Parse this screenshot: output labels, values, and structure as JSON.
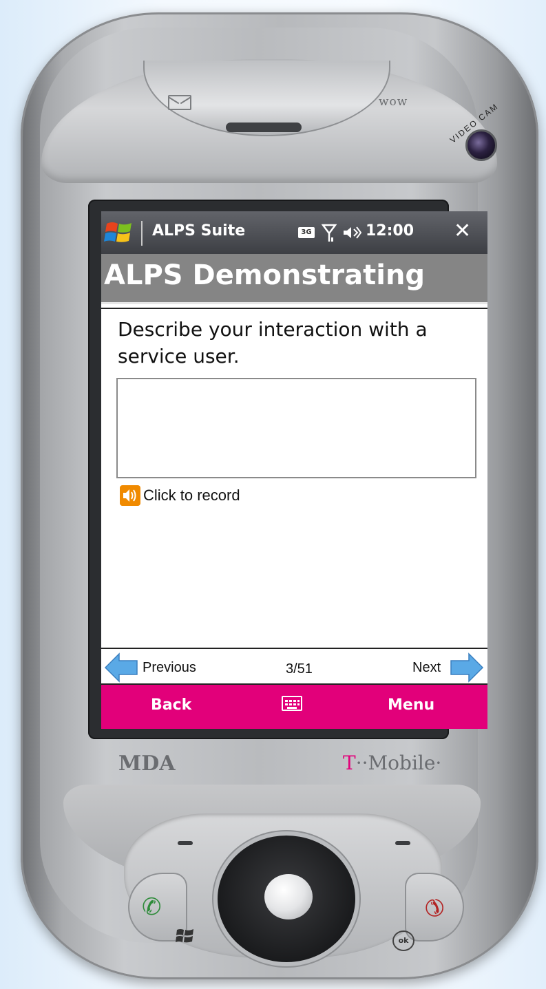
{
  "device": {
    "brand_left": "MDA",
    "brand_right_t": "T",
    "brand_right_rest": "··Mobile·",
    "camera_label": "VIDEO CAM",
    "top_logo": "wow",
    "ok_key_label": "ok"
  },
  "statusbar": {
    "app_title": "ALPS Suite",
    "network_badge": "3G",
    "time": "12:00",
    "close_glyph": "✕"
  },
  "page": {
    "header": "ALPS Demonstrating",
    "question": "Describe your interaction with a service user.",
    "answer_value": "",
    "record_label": "Click to record"
  },
  "pager": {
    "previous_label": "Previous",
    "page_indicator": "3/51",
    "next_label": "Next"
  },
  "softkeys": {
    "left_label": "Back",
    "right_label": "Menu"
  },
  "colors": {
    "softkey_bar": "#e2007a",
    "header_bg": "#858585",
    "titlebar_bg": "#3d3f44",
    "arrow_blue": "#5aa9e6",
    "record_orange": "#f08a00"
  },
  "icons": {
    "start": "windows-flag-icon",
    "signal": "antenna-signal-icon",
    "volume": "speaker-volume-icon",
    "record": "speaker-record-icon",
    "keyboard": "keyboard-icon",
    "prev": "left-arrow-icon",
    "next": "right-arrow-icon"
  }
}
